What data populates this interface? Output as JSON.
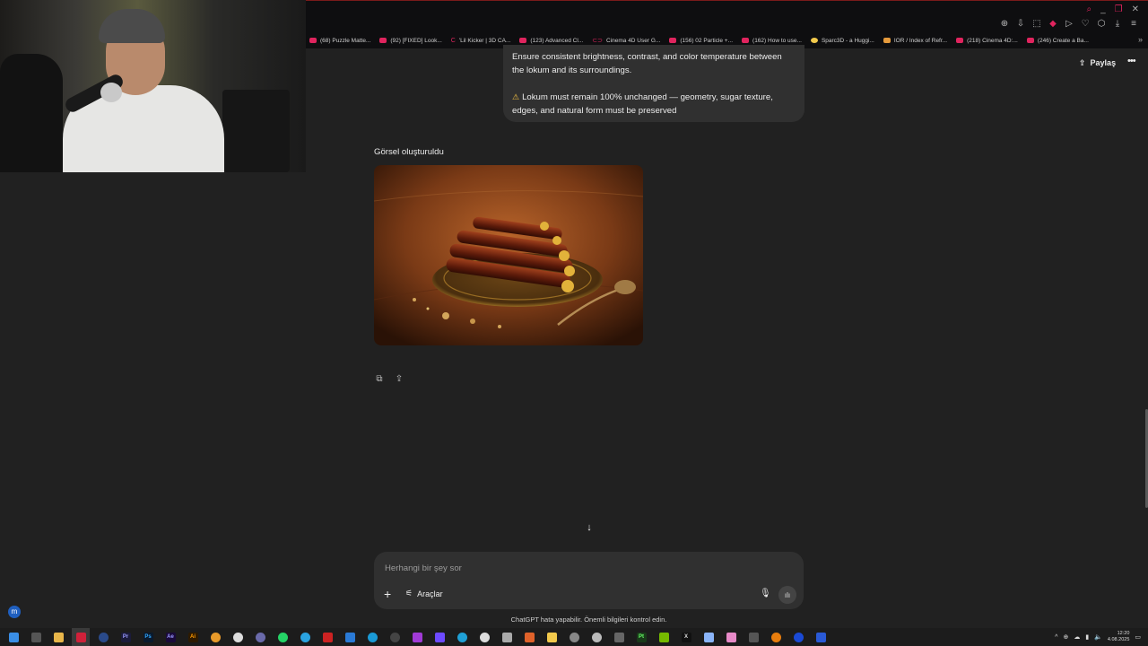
{
  "browser": {
    "bookmarks": [
      {
        "label": "(68) Puzzle Matte...",
        "icon": "youtube-icon"
      },
      {
        "label": "(92) [FIXED] Look...",
        "icon": "youtube-icon"
      },
      {
        "label": "'Lil Kicker | 3D CA...",
        "icon": "c-icon"
      },
      {
        "label": "(123) Advanced Cl...",
        "icon": "youtube-icon"
      },
      {
        "label": "Cinema 4D User G...",
        "icon": "c4d-icon"
      },
      {
        "label": "(156) 02 Particle +...",
        "icon": "youtube-icon"
      },
      {
        "label": "(162) How to use...",
        "icon": "youtube-icon"
      },
      {
        "label": "Sparc3D - a Huggi...",
        "icon": "huggingface-icon"
      },
      {
        "label": "IOR / Index of Refr...",
        "icon": "web-icon"
      },
      {
        "label": "(218) Cinema 4D:...",
        "icon": "youtube-icon"
      },
      {
        "label": "(246) Create a Ba...",
        "icon": "youtube-icon"
      }
    ]
  },
  "header": {
    "share_label": "Paylaş"
  },
  "conversation": {
    "user_message": {
      "line1": "Ensure consistent brightness, contrast, and color temperature between the lokum and its surroundings.",
      "line2": "Lokum must remain 100% unchanged — geometry, sugar texture, edges, and natural form must be preserved"
    },
    "assistant": {
      "status_label": "Görsel oluşturuldu"
    }
  },
  "composer": {
    "placeholder": "Herhangi bir şey sor",
    "tools_label": "Araçlar"
  },
  "disclaimer": "ChatGPT hata yapabilir. Önemli bilgileri kontrol edin.",
  "avatar_letter": "m",
  "taskbar": {
    "time": "12:20",
    "date": "4.08.2025"
  },
  "colors": {
    "background": "#212121",
    "bubble": "#303030",
    "accent_red": "#e0245e"
  }
}
